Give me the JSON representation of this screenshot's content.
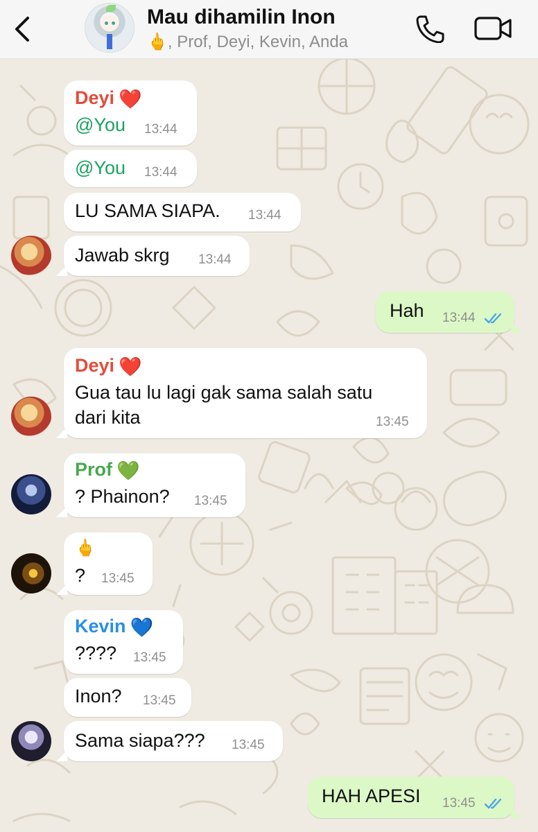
{
  "header": {
    "title": "Mau dihamilin Inon",
    "subtitle": "🖕, Prof, Deyi, Kevin, Anda",
    "back_icon": "chevron-left-icon",
    "call_icon": "phone-icon",
    "video_icon": "video-camera-icon"
  },
  "colors": {
    "incoming_bubble": "#ffffff",
    "outgoing_bubble": "#dcf8c6",
    "deyi_name": "#e24c3c",
    "prof_name": "#48a84f",
    "kevin_name": "#2b8ee6",
    "mention": "#1aa35f",
    "read_ticks": "#4aa6e6",
    "wallpaper": "#efeae2"
  },
  "messages": [
    {
      "sender": "Deyi",
      "heart": "❤️",
      "text": "@You",
      "time": "13:44"
    },
    {
      "text": "@You",
      "time": "13:44"
    },
    {
      "text": "LU SAMA SIAPA.",
      "time": "13:44"
    },
    {
      "text": "Jawab skrg",
      "time": "13:44"
    },
    {
      "text": "Hah",
      "time": "13:44",
      "outgoing": true,
      "status": "read"
    },
    {
      "sender": "Deyi",
      "heart": "❤️",
      "text_line1": "Gua tau lu lagi gak sama salah satu",
      "text_line2": "dari kita",
      "time": "13:45"
    },
    {
      "sender": "Prof",
      "heart": "💚",
      "text": "? Phainon?",
      "time": "13:45"
    },
    {
      "sender": "🖕",
      "text": "?",
      "time": "13:45"
    },
    {
      "sender": "Kevin",
      "heart": "💙",
      "text": "????",
      "time": "13:45"
    },
    {
      "text": "Inon?",
      "time": "13:45"
    },
    {
      "text": "Sama siapa???",
      "time": "13:45"
    },
    {
      "text": "HAH APESI",
      "time": "13:45",
      "outgoing": true,
      "status": "read"
    }
  ]
}
